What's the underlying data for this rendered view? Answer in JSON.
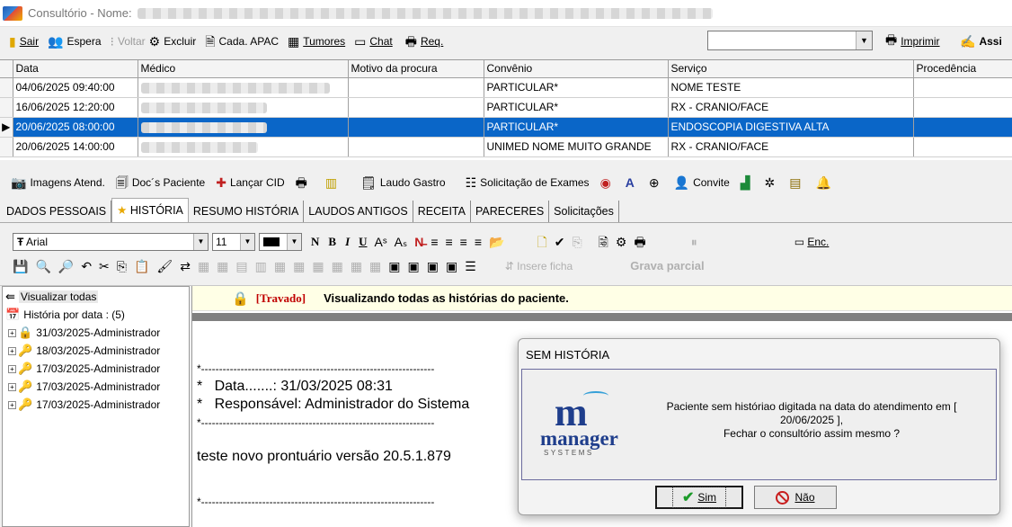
{
  "window": {
    "title": "Consultório - Nome:"
  },
  "toolbar": {
    "sair": "Sair",
    "espera": "Espera",
    "voltar": "Voltar",
    "excluir": "Excluir",
    "cada_apac": "Cada. APAC",
    "tumores": "Tumores",
    "chat": "Chat",
    "req": "Req.",
    "imprimir": "Imprimir",
    "assi": "Assi"
  },
  "grid": {
    "columns": [
      "Data",
      "Médico",
      "Motivo da procura",
      "Convênio",
      "Serviço",
      "Procedência"
    ],
    "rows": [
      {
        "data": "04/06/2025 09:40:00",
        "medico": "",
        "motivo": "",
        "convenio": "PARTICULAR*",
        "servico": "NOME TESTE",
        "procedencia": ""
      },
      {
        "data": "16/06/2025 12:20:00",
        "medico": "",
        "motivo": "",
        "convenio": "PARTICULAR*",
        "servico": "RX - CRANIO/FACE",
        "procedencia": ""
      },
      {
        "data": "20/06/2025 08:00:00",
        "medico": "",
        "motivo": "",
        "convenio": "PARTICULAR*",
        "servico": "ENDOSCOPIA DIGESTIVA ALTA",
        "procedencia": ""
      },
      {
        "data": "20/06/2025 14:00:00",
        "medico": "",
        "motivo": "",
        "convenio": "UNIMED NOME MUITO GRANDE",
        "servico": "RX - CRANIO/FACE",
        "procedencia": ""
      }
    ],
    "selected_row": 2
  },
  "actions": {
    "imagens": "Imagens Atend.",
    "docs": "Doc´s Paciente",
    "cid": "Lançar CID",
    "laudo": "Laudo Gastro",
    "solicitacao": "Solicitação de Exames",
    "convite": "Convite"
  },
  "tabs": [
    "DADOS PESSOAIS",
    "HISTÓRIA",
    "RESUMO HISTÓRIA",
    "LAUDOS ANTIGOS",
    "RECEITA",
    "PARECERES",
    "Solicitações"
  ],
  "active_tab": "HISTÓRIA",
  "editor": {
    "font": "Arial",
    "size": "11",
    "bold": "N",
    "bold2": "B",
    "italic": "I",
    "underline": "U",
    "insere_ficha": "Insere ficha",
    "grava_parcial": "Grava parcial",
    "enc": "Enc."
  },
  "tree": {
    "visualizar": "Visualizar todas",
    "historia_por_data": "História por data : (5)",
    "items": [
      {
        "label": "31/03/2025-Administrador",
        "icon": "lock"
      },
      {
        "label": "18/03/2025-Administrador",
        "icon": "key"
      },
      {
        "label": "17/03/2025-Administrador",
        "icon": "key"
      },
      {
        "label": "17/03/2025-Administrador",
        "icon": "key"
      },
      {
        "label": "17/03/2025-Administrador",
        "icon": "key"
      }
    ]
  },
  "content": {
    "travado": "[Travado]",
    "visualizando": "Visualizando todas as histórias do paciente.",
    "sep": "*-----------------------------------------------------------------",
    "data_line": "*   Data.......: 31/03/2025 08:31",
    "resp_line": "*   Responsável: Administrador do Sistema",
    "body": "teste novo prontuário versão 20.5.1.879"
  },
  "dialog": {
    "title": "SEM HISTÓRIA",
    "message_line1": "Paciente sem históriao digitada na data do atendimento em [",
    "message_line2": "20/06/2025 ],",
    "message_line3": "Fechar o consultório assim mesmo ?",
    "yes": "Sim",
    "no": "Não",
    "logo_word": "manager",
    "logo_sub": "SYSTEMS"
  }
}
